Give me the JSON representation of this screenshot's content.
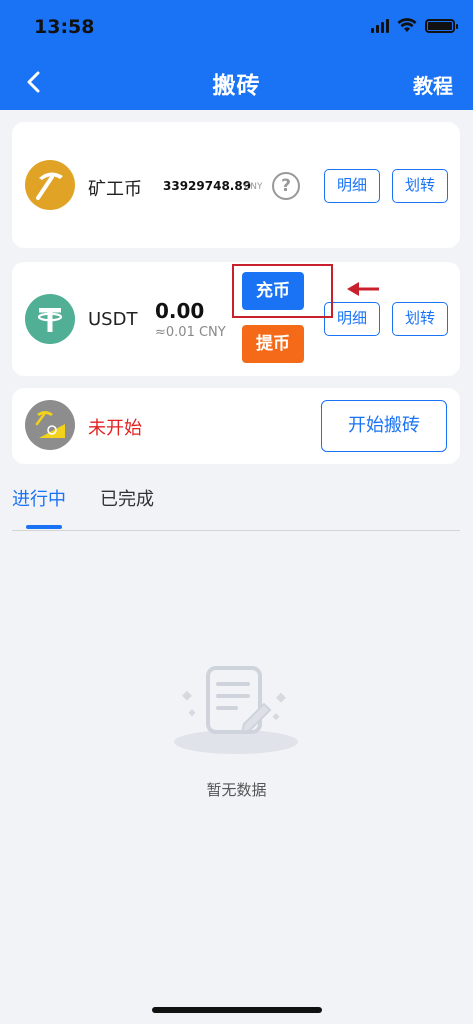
{
  "status_bar": {
    "time": "13:58"
  },
  "nav": {
    "title": "搬砖",
    "right_label": "教程"
  },
  "miner_card": {
    "name": "矿工币",
    "amount": "33929748.89",
    "unit": "CNY",
    "help": "?",
    "detail_label": "明细",
    "transfer_label": "划转"
  },
  "usdt_card": {
    "name": "USDT",
    "amount": "0.00",
    "cny_value": "≈0.01 CNY",
    "deposit_label": "充币",
    "withdraw_label": "提币",
    "detail_label": "明细",
    "transfer_label": "划转"
  },
  "status_card": {
    "status": "未开始",
    "start_label": "开始搬砖"
  },
  "tabs": [
    {
      "label": "进行中"
    },
    {
      "label": "已完成"
    }
  ],
  "empty": {
    "text": "暂无数据"
  },
  "colors": {
    "primary": "#1a73f5",
    "orange": "#f56a18",
    "red": "#e32222",
    "gold": "#e0a326",
    "teal": "#50af95"
  }
}
